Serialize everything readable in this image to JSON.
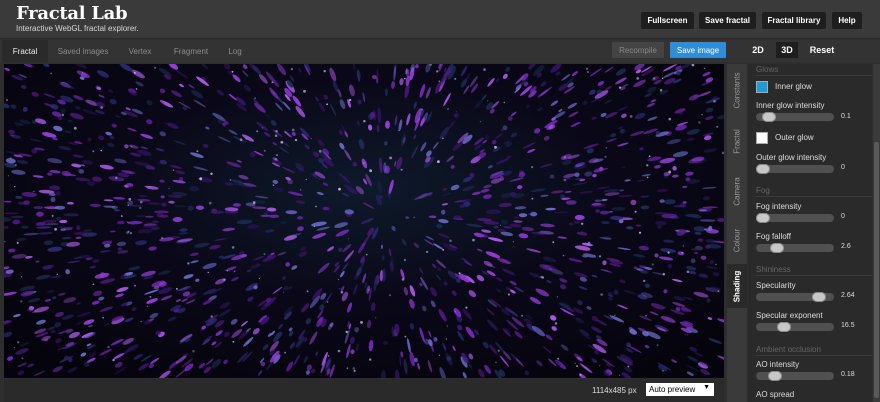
{
  "app": {
    "title": "Fractal Lab",
    "tagline": "Interactive WebGL fractal explorer."
  },
  "header_buttons": [
    "Fullscreen",
    "Save fractal",
    "Fractal library",
    "Help"
  ],
  "tabs": [
    {
      "label": "Fractal",
      "active": true
    },
    {
      "label": "Saved images",
      "active": false
    },
    {
      "label": "Vertex",
      "active": false
    },
    {
      "label": "Fragment",
      "active": false
    },
    {
      "label": "Log",
      "active": false
    }
  ],
  "toolbar": {
    "recompile": "Recompile",
    "save_image": "Save image",
    "accent": "#2f8dd8"
  },
  "modes": {
    "d2": "2D",
    "d3": "3D",
    "reset": "Reset",
    "selected": "3D"
  },
  "status": {
    "resolution": "1114x485 px",
    "preview_select": "Auto preview"
  },
  "side_tabs": [
    {
      "label": "Constants",
      "active": false
    },
    {
      "label": "Fractal",
      "active": false
    },
    {
      "label": "Camera",
      "active": false
    },
    {
      "label": "Colour",
      "active": false
    },
    {
      "label": "Shading",
      "active": true
    }
  ],
  "panel": {
    "glows": {
      "title": "Glows",
      "inner_glow": {
        "label": "Inner glow",
        "color": "#1e9bd7"
      },
      "inner_glow_intensity": {
        "label": "Inner glow intensity",
        "value": "0.1",
        "fraction": 0.1
      },
      "outer_glow": {
        "label": "Outer glow",
        "color": "#ffffff"
      },
      "outer_glow_intensity": {
        "label": "Outer glow intensity",
        "value": "0",
        "fraction": 0.0
      }
    },
    "fog": {
      "title": "Fog",
      "fog_intensity": {
        "label": "Fog intensity",
        "value": "0",
        "fraction": 0.0
      },
      "fog_falloff": {
        "label": "Fog falloff",
        "value": "2.6",
        "fraction": 0.22
      }
    },
    "shininess": {
      "title": "Shininess",
      "specularity": {
        "label": "Specularity",
        "value": "2.64",
        "fraction": 0.88
      },
      "specular_exponent": {
        "label": "Specular exponent",
        "value": "16.5",
        "fraction": 0.33
      }
    },
    "ambient_occlusion": {
      "title": "Ambient occlusion",
      "ao_intensity": {
        "label": "AO intensity",
        "value": "0.18",
        "fraction": 0.18
      },
      "ao_spread": {
        "label": "AO spread"
      }
    }
  }
}
